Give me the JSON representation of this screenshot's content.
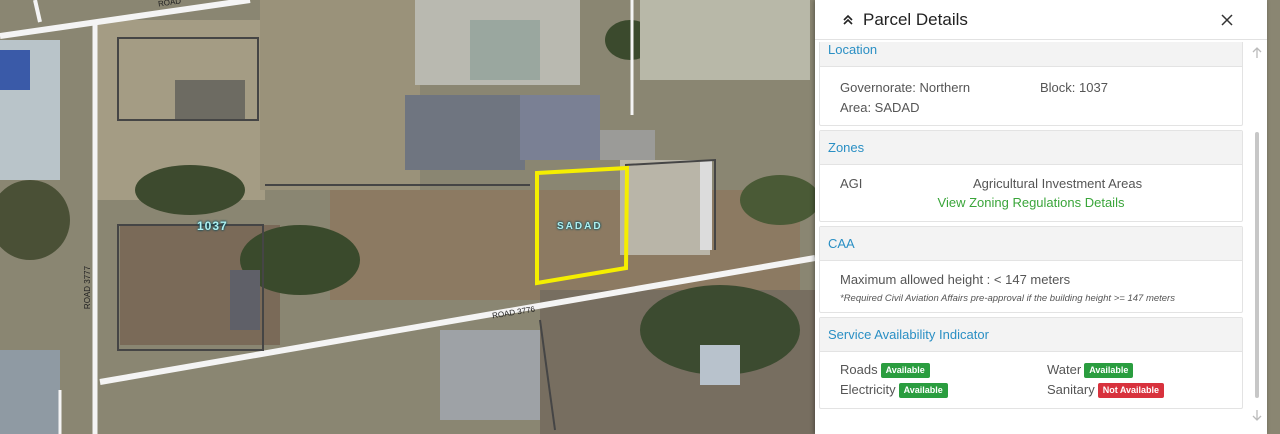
{
  "map": {
    "road_top": "ROAD",
    "road_left": "ROAD 3777",
    "road_bottom": "ROAD 3776",
    "block_label": "1037",
    "parcel_label": "SADAD"
  },
  "panel": {
    "title": "Parcel Details",
    "sections": {
      "location": {
        "heading": "Location",
        "governorate": "Governorate: Northern",
        "block": "Block: 1037",
        "area": "Area: SADAD"
      },
      "zones": {
        "heading": "Zones",
        "code": "AGI",
        "name": "Agricultural Investment Areas",
        "link": "View Zoning Regulations Details"
      },
      "caa": {
        "heading": "CAA",
        "height": "Maximum allowed height : < 147 meters",
        "note": "*Required Civil Aviation Affairs pre-approval if the building height >= 147 meters"
      },
      "services": {
        "heading": "Service Availability Indicator",
        "items": [
          {
            "label": "Roads",
            "status": "Available"
          },
          {
            "label": "Water",
            "status": "Available"
          },
          {
            "label": "Electricity",
            "status": "Available"
          },
          {
            "label": "Sanitary",
            "status": "Not Available"
          }
        ]
      }
    }
  },
  "colors": {
    "section_heading": "#2a8fc4",
    "link": "#3aa53a",
    "available": "#2a9d3f",
    "not_available": "#d8323d",
    "parcel_outline": "#f5ee00"
  },
  "icons": {
    "collapse": "chevron-up-double-icon",
    "close": "close-icon",
    "scroll_up": "arrow-up-icon",
    "scroll_down": "arrow-down-icon"
  }
}
